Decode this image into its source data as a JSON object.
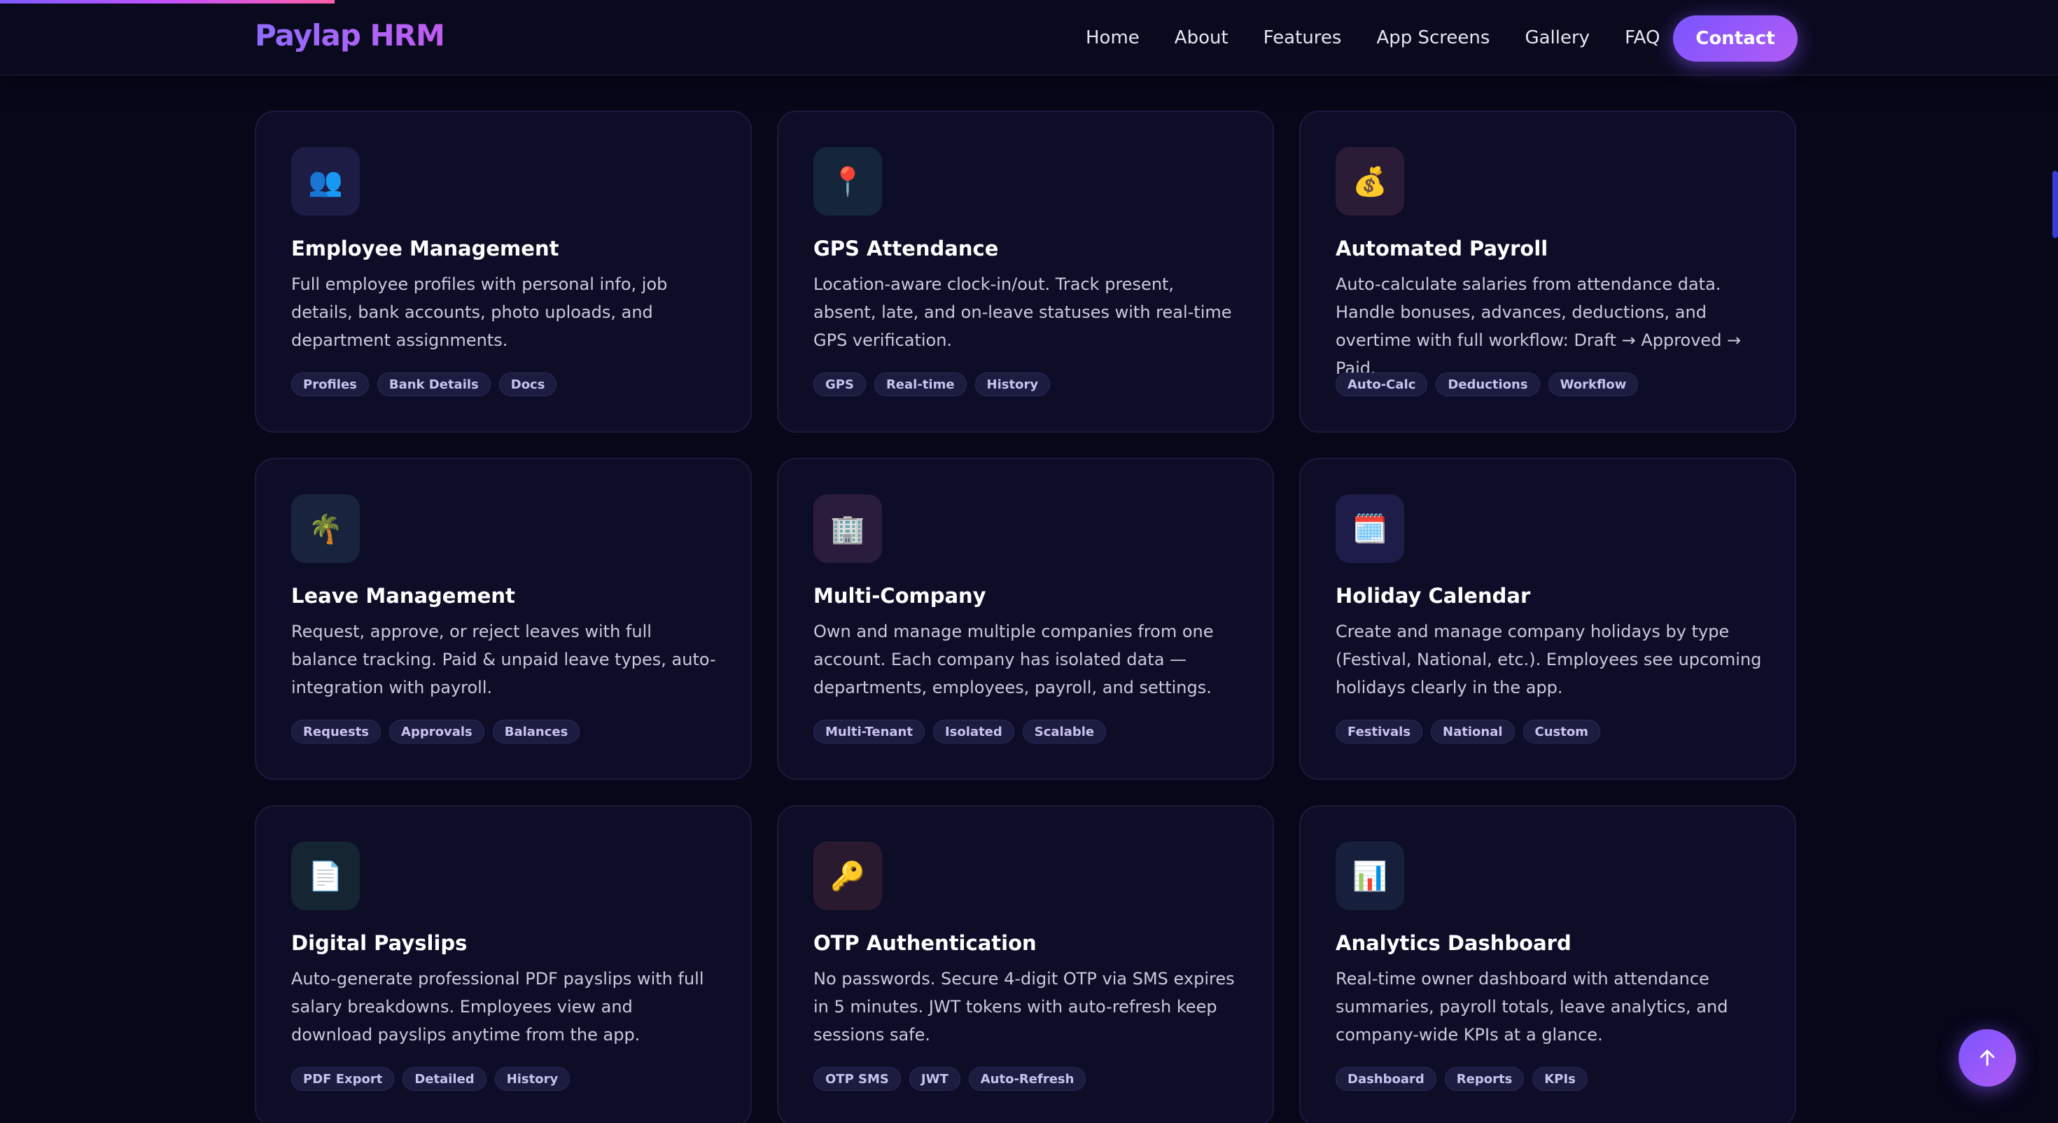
{
  "brand": "Paylap HRM",
  "nav": {
    "links": [
      "Home",
      "About",
      "Features",
      "App Screens",
      "Gallery",
      "FAQ"
    ],
    "contact": "Contact"
  },
  "cards": [
    {
      "icon": "👥",
      "icon_name": "people-icon",
      "icon_bg": "#1c1c44",
      "title": "Employee Management",
      "desc": "Full employee profiles with personal info, job details, bank accounts, photo uploads, and department assignments.",
      "tags": [
        "Profiles",
        "Bank Details",
        "Docs"
      ]
    },
    {
      "icon": "📍",
      "icon_name": "pin-icon",
      "icon_bg": "#15253a",
      "title": "GPS Attendance",
      "desc": "Location-aware clock-in/out. Track present, absent, late, and on-leave statuses with real-time GPS verification.",
      "tags": [
        "GPS",
        "Real-time",
        "History"
      ]
    },
    {
      "icon": "💰",
      "icon_name": "money-bag-icon",
      "icon_bg": "#2a1c36",
      "title": "Automated Payroll",
      "desc": "Auto-calculate salaries from attendance data. Handle bonuses, advances, deductions, and overtime with full workflow: Draft → Approved → Paid.",
      "tags": [
        "Auto-Calc",
        "Deductions",
        "Workflow"
      ]
    },
    {
      "icon": "🌴",
      "icon_name": "palm-tree-icon",
      "icon_bg": "#18243e",
      "title": "Leave Management",
      "desc": "Request, approve, or reject leaves with full balance tracking. Paid & unpaid leave types, auto-integration with payroll.",
      "tags": [
        "Requests",
        "Approvals",
        "Balances"
      ]
    },
    {
      "icon": "🏢",
      "icon_name": "building-icon",
      "icon_bg": "#291c3c",
      "title": "Multi-Company",
      "desc": "Own and manage multiple companies from one account. Each company has isolated data — departments, employees, payroll, and settings.",
      "tags": [
        "Multi-Tenant",
        "Isolated",
        "Scalable"
      ]
    },
    {
      "icon": "🗓️",
      "icon_name": "calendar-icon",
      "icon_bg": "#1e1c48",
      "title": "Holiday Calendar",
      "desc": "Create and manage company holidays by type (Festival, National, etc.). Employees see upcoming holidays clearly in the app.",
      "tags": [
        "Festivals",
        "National",
        "Custom"
      ]
    },
    {
      "icon": "📄",
      "icon_name": "document-icon",
      "icon_bg": "#162532",
      "title": "Digital Payslips",
      "desc": "Auto-generate professional PDF payslips with full salary breakdowns. Employees view and download payslips anytime from the app.",
      "tags": [
        "PDF Export",
        "Detailed",
        "History"
      ]
    },
    {
      "icon": "🔑",
      "icon_name": "key-icon",
      "icon_bg": "#2a1a30",
      "title": "OTP Authentication",
      "desc": "No passwords. Secure 4-digit OTP via SMS expires in 5 minutes. JWT tokens with auto-refresh keep sessions safe.",
      "tags": [
        "OTP SMS",
        "JWT",
        "Auto-Refresh"
      ]
    },
    {
      "icon": "📊",
      "icon_name": "bar-chart-icon",
      "icon_bg": "#161f3c",
      "title": "Analytics Dashboard",
      "desc": "Real-time owner dashboard with attendance summaries, payroll totals, leave analytics, and company-wide KPIs at a glance.",
      "tags": [
        "Dashboard",
        "Reports",
        "KPIs"
      ]
    }
  ]
}
